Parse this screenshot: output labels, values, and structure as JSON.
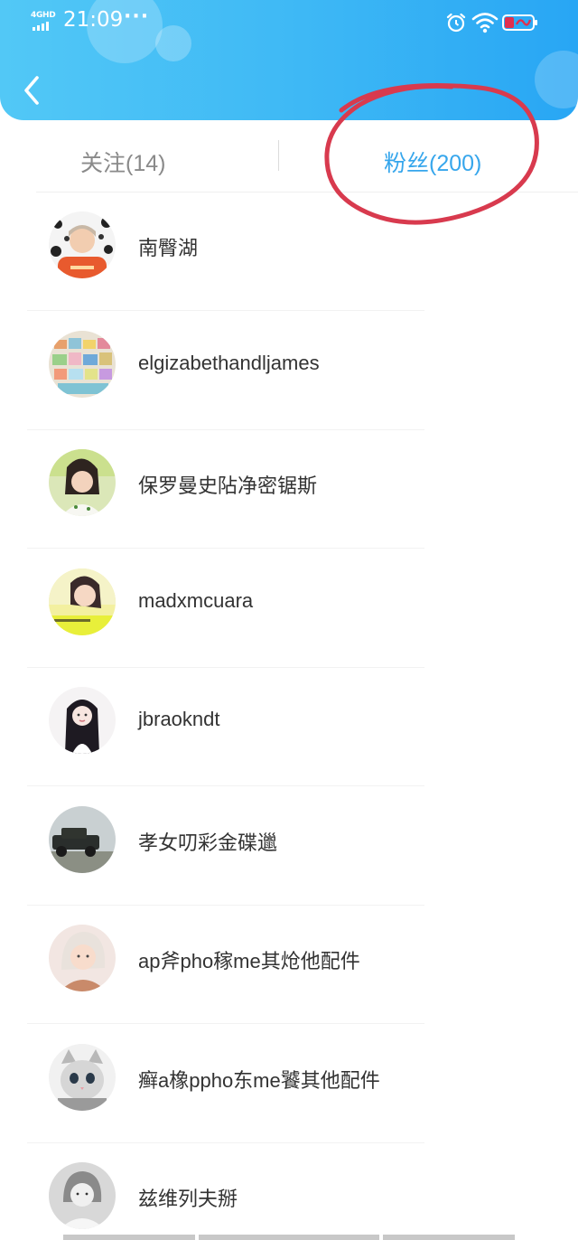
{
  "status_bar": {
    "network": "4GHD",
    "time": "21:09",
    "more": "···",
    "icons": [
      "alarm-icon",
      "wifi-icon",
      "battery-icon"
    ]
  },
  "nav": {
    "back_icon": "chevron-left-icon"
  },
  "tabs": [
    {
      "label": "关注(14)",
      "active": false
    },
    {
      "label": "粉丝(200)",
      "active": true
    }
  ],
  "fans": [
    {
      "name": "南臀湖",
      "avatar": "avatar-1"
    },
    {
      "name": "elgizabethandljames",
      "avatar": "avatar-2"
    },
    {
      "name": "保罗曼史阽净密锯斯",
      "avatar": "avatar-3"
    },
    {
      "name": "madxmcuara",
      "avatar": "avatar-4"
    },
    {
      "name": "jbraokndt",
      "avatar": "avatar-5"
    },
    {
      "name": "孝女叨彩金碟邋",
      "avatar": "avatar-6"
    },
    {
      "name": "ap斧pho稼me其炝他配件",
      "avatar": "avatar-7"
    },
    {
      "name": "癣a橡ppho东me饕其他配件",
      "avatar": "avatar-8"
    },
    {
      "name": "兹维列夫掰",
      "avatar": "avatar-9"
    }
  ],
  "colors": {
    "header_gradient": [
      "#52c8f6",
      "#28a6f4"
    ],
    "active_tab": "#36a6ec",
    "inactive_tab": "#8a8a8a",
    "annotation": "#d83a4e"
  }
}
